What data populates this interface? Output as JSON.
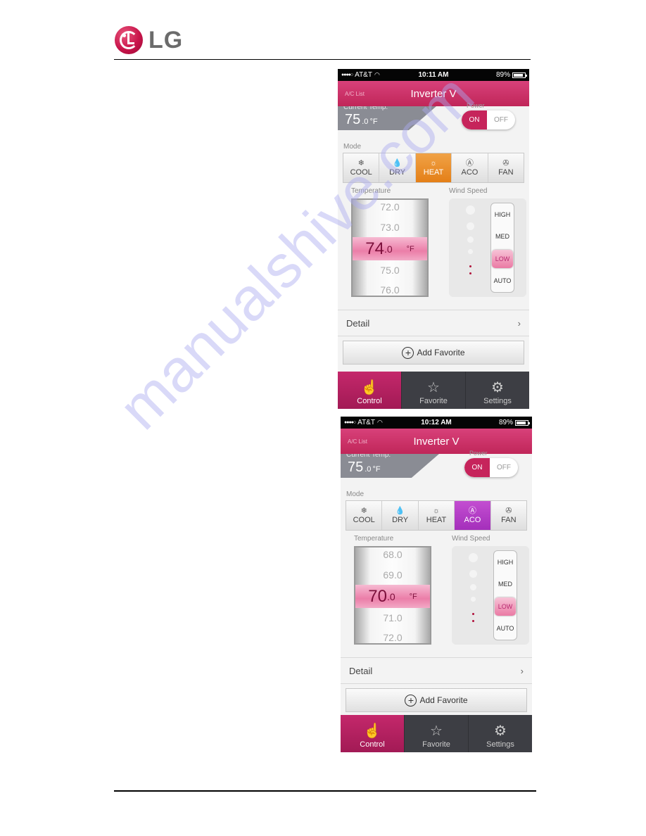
{
  "page": {
    "logo_text": "LG",
    "watermark": "manualshive.com"
  },
  "phones": [
    {
      "status": {
        "carrier": "AT&T",
        "signal": "●●●●○",
        "time": "10:11 AM",
        "battery": "89%",
        "battery_level": 0.89
      },
      "nav": {
        "back_label": "A/C List",
        "title": "Inverter V"
      },
      "current_temp": {
        "label": "Current Temp.",
        "value": "75",
        "decimal": ".0",
        "unit": "°F"
      },
      "power": {
        "label": "Power",
        "on_label": "ON",
        "off_label": "OFF",
        "state": "ON"
      },
      "mode": {
        "label": "Mode",
        "selected": "HEAT",
        "items": [
          {
            "label": "COOL",
            "icon": "snowflake-icon",
            "glyph": "❄"
          },
          {
            "label": "DRY",
            "icon": "droplet-icon",
            "glyph": "💧"
          },
          {
            "label": "HEAT",
            "icon": "sun-icon",
            "glyph": "☼"
          },
          {
            "label": "ACO",
            "icon": "ai-icon",
            "glyph": "Ⓐ"
          },
          {
            "label": "FAN",
            "icon": "fan-icon",
            "glyph": "✇"
          }
        ]
      },
      "temperature": {
        "label": "Temperature",
        "values": [
          "72.0",
          "73.0",
          "75.0",
          "76.0"
        ],
        "selected_int": "74",
        "selected_dec": ".0",
        "unit": "°F"
      },
      "wind": {
        "label": "Wind Speed",
        "options": [
          "HIGH",
          "MED",
          "LOW",
          "AUTO"
        ],
        "selected": "LOW"
      },
      "detail": {
        "label": "Detail",
        "chevron": "›"
      },
      "add_favorite": {
        "label": "Add Favorite",
        "icon": "+"
      },
      "tabs": [
        {
          "label": "Control",
          "icon": "touch-icon",
          "glyph": "☝",
          "active": true
        },
        {
          "label": "Favorite",
          "icon": "star-icon",
          "glyph": "☆",
          "active": false
        },
        {
          "label": "Settings",
          "icon": "gear-icon",
          "glyph": "⚙",
          "active": false
        }
      ]
    },
    {
      "status": {
        "carrier": "AT&T",
        "signal": "●●●●○",
        "time": "10:12 AM",
        "battery": "89%",
        "battery_level": 0.89
      },
      "nav": {
        "back_label": "A/C List",
        "title": "Inverter V"
      },
      "current_temp": {
        "label": "Current Temp.",
        "value": "75",
        "decimal": ".0",
        "unit": "°F"
      },
      "power": {
        "label": "Power",
        "on_label": "ON",
        "off_label": "OFF",
        "state": "ON"
      },
      "mode": {
        "label": "Mode",
        "selected": "ACO",
        "items": [
          {
            "label": "COOL",
            "icon": "snowflake-icon",
            "glyph": "❄"
          },
          {
            "label": "DRY",
            "icon": "droplet-icon",
            "glyph": "💧"
          },
          {
            "label": "HEAT",
            "icon": "sun-icon",
            "glyph": "☼"
          },
          {
            "label": "ACO",
            "icon": "ai-icon",
            "glyph": "Ⓐ"
          },
          {
            "label": "FAN",
            "icon": "fan-icon",
            "glyph": "✇"
          }
        ]
      },
      "temperature": {
        "label": "Temperature",
        "values": [
          "68.0",
          "69.0",
          "71.0",
          "72.0"
        ],
        "selected_int": "70",
        "selected_dec": ".0",
        "unit": "°F"
      },
      "wind": {
        "label": "Wind Speed",
        "options": [
          "HIGH",
          "MED",
          "LOW",
          "AUTO"
        ],
        "selected": "LOW"
      },
      "detail": {
        "label": "Detail",
        "chevron": "›"
      },
      "add_favorite": {
        "label": "Add Favorite",
        "icon": "+"
      },
      "tabs": [
        {
          "label": "Control",
          "icon": "touch-icon",
          "glyph": "☝",
          "active": true
        },
        {
          "label": "Favorite",
          "icon": "star-icon",
          "glyph": "☆",
          "active": false
        },
        {
          "label": "Settings",
          "icon": "gear-icon",
          "glyph": "⚙",
          "active": false
        }
      ]
    }
  ],
  "colors": {
    "brand_magenta": "#c6245b",
    "heat_active": "#e8891f",
    "aco_active": "#b23ec6",
    "tabbar_dark": "#3d3e44",
    "logo_gray": "#6b6b6b"
  }
}
